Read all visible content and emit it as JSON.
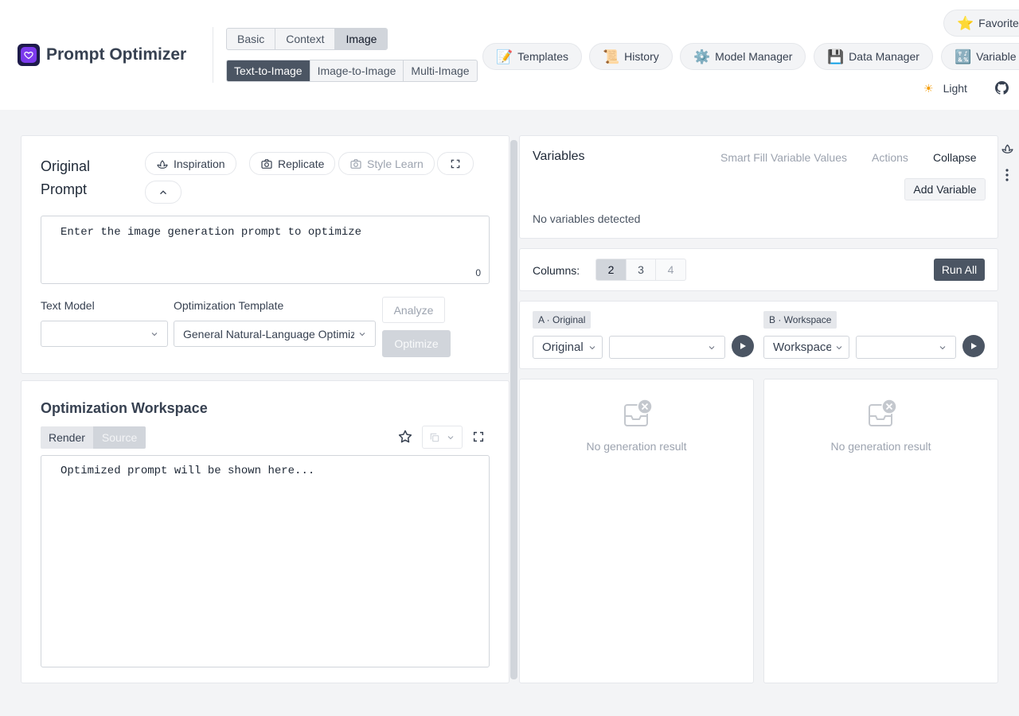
{
  "header": {
    "app_title": "Prompt Optimizer",
    "mode_tabs": [
      "Basic",
      "Context",
      "Image"
    ],
    "sub_tabs": [
      "Text-to-Image",
      "Image-to-Image",
      "Multi-Image"
    ],
    "nav": {
      "templates": "Templates",
      "history": "History",
      "model_manager": "Model Manager",
      "data_manager": "Data Manager",
      "variable": "Variable",
      "favorite": "Favorite"
    },
    "theme_label": "Light",
    "accent_color": "#7c3aed"
  },
  "original_prompt": {
    "title": "Original Prompt",
    "chips": {
      "inspiration": "Inspiration",
      "replicate": "Replicate",
      "style_learn": "Style Learn"
    },
    "placeholder": "Enter the image generation prompt to optimize",
    "char_count": "0",
    "text_model_label": "Text Model",
    "text_model_value": "",
    "template_label": "Optimization Template",
    "template_value": "General Natural-Language Optimization",
    "analyze_label": "Analyze",
    "optimize_label": "Optimize"
  },
  "workspace": {
    "title": "Optimization Workspace",
    "view_tabs": [
      "Render",
      "Source"
    ],
    "placeholder": "Optimized prompt will be shown here..."
  },
  "variables": {
    "title": "Variables",
    "smart_fill": "Smart Fill Variable Values",
    "actions": "Actions",
    "collapse": "Collapse",
    "add_variable": "Add Variable",
    "empty_text": "No variables detected"
  },
  "columns": {
    "label": "Columns:",
    "options": [
      "2",
      "3",
      "4"
    ],
    "selected": "2",
    "run_all": "Run All"
  },
  "compare": {
    "a_tag": "A · Original",
    "a_select": "Original",
    "a_model": "",
    "b_tag": "B · Workspace",
    "b_select": "Workspace",
    "b_model": ""
  },
  "results": {
    "a_empty": "No generation result",
    "b_empty": "No generation result"
  }
}
